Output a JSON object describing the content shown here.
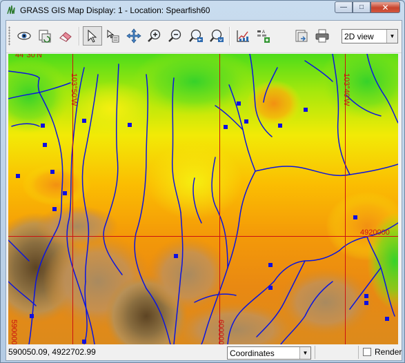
{
  "window": {
    "title": "GRASS GIS Map Display: 1 - Location: Spearfish60",
    "buttons": {
      "minimize": "—",
      "maximize": "□",
      "close": "✕"
    }
  },
  "toolbar": {
    "tools": [
      {
        "name": "display-map-icon",
        "active": false
      },
      {
        "name": "render-map-icon",
        "active": false
      },
      {
        "name": "erase-display-icon",
        "active": false
      },
      {
        "name": "pointer-icon",
        "active": true
      },
      {
        "name": "query-icon",
        "active": false
      },
      {
        "name": "pan-icon",
        "active": false
      },
      {
        "name": "zoom-in-icon",
        "active": false
      },
      {
        "name": "zoom-out-icon",
        "active": false
      },
      {
        "name": "zoom-back-icon",
        "active": false
      },
      {
        "name": "zoom-menu-icon",
        "active": false
      },
      {
        "name": "analyze-icon",
        "active": false
      },
      {
        "name": "overlay-icon",
        "active": false
      },
      {
        "name": "save-icon",
        "active": false
      },
      {
        "name": "print-icon",
        "active": false
      }
    ],
    "view_mode": "2D view"
  },
  "map": {
    "grid_labels": {
      "top_left": "44°30'N",
      "lon_west": "103°50'W",
      "lon_east": "103°40'W",
      "northing": "4920000",
      "easting_west": "590000",
      "easting_east": "600000"
    },
    "colors": {
      "grid": "#cc1111",
      "streams": "#0a14e0",
      "points": "#1010e0"
    }
  },
  "statusbar": {
    "coordinates": "590050.09, 4922702.99",
    "mode": "Coordinates",
    "render_label": "Render",
    "render_checked": false
  }
}
